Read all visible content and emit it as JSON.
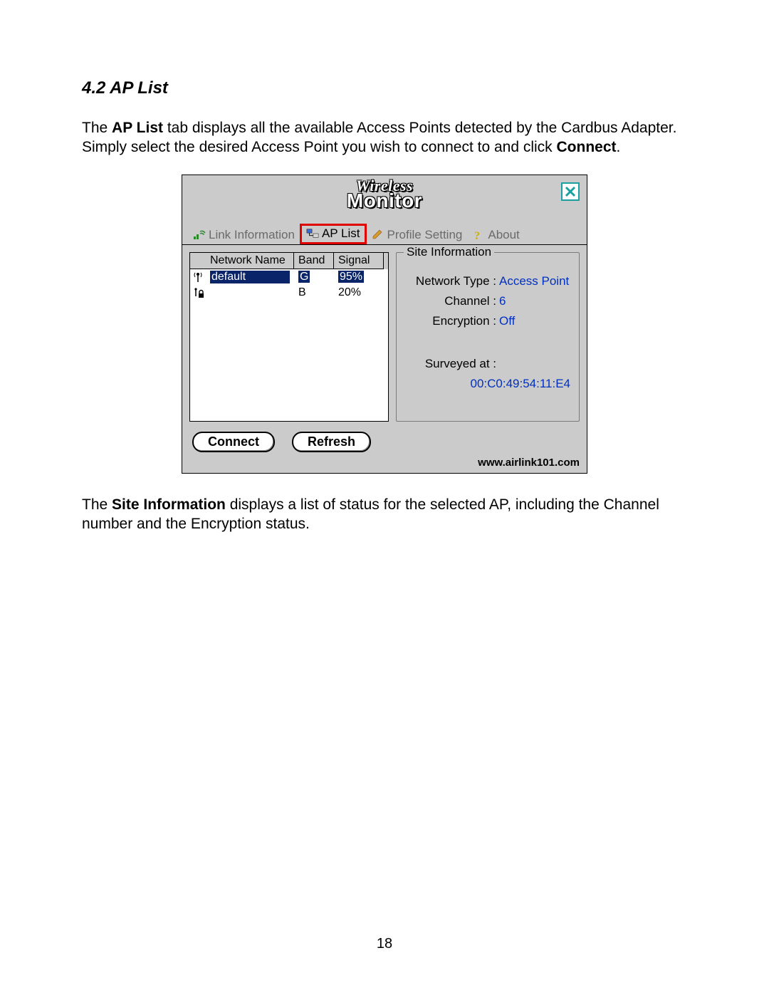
{
  "doc": {
    "section_heading": "4.2 AP List",
    "para1_pre": "The ",
    "para1_bold": "AP List",
    "para1_post": " tab displays all the available Access Points detected by the Cardbus Adapter. Simply select the desired Access Point you wish to connect to and click ",
    "para1_bold2": "Connect",
    "para1_tail": ".",
    "para2_pre": "The ",
    "para2_bold": "Site Information",
    "para2_post": " displays a list of status for the selected AP, including the Channel number and the Encryption status.",
    "page_number": "18"
  },
  "app": {
    "logo_top": "Wireless",
    "logo_bottom": "Monitor",
    "tabs": {
      "link_info": "Link Information",
      "ap_list": "AP List",
      "profile_setting": "Profile Setting",
      "about": "About"
    },
    "columns": {
      "name": "Network Name",
      "band": "Band",
      "signal": "Signal"
    },
    "rows": [
      {
        "name": "default",
        "band": "G",
        "signal": "95%",
        "locked": false,
        "selected": true
      },
      {
        "name": "",
        "band": "B",
        "signal": "20%",
        "locked": true,
        "selected": false
      }
    ],
    "buttons": {
      "connect": "Connect",
      "refresh": "Refresh"
    },
    "site_info": {
      "title": "Site Information",
      "net_type_label": "Network Type :",
      "net_type_value": "Access Point",
      "channel_label": "Channel :",
      "channel_value": "6",
      "encryption_label": "Encryption :",
      "encryption_value": "Off",
      "surveyed_label": "Surveyed at :",
      "mac": "00:C0:49:54:11:E4"
    },
    "footer_url": "www.airlink101.com"
  }
}
